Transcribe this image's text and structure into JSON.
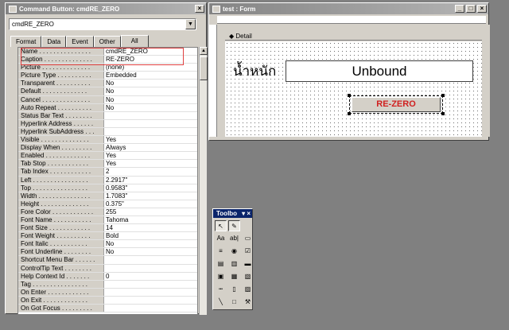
{
  "property_sheet": {
    "title": "Command Button: cmdRE_ZERO",
    "selector_value": "cmdRE_ZERO",
    "tabs": [
      "Format",
      "Data",
      "Event",
      "Other",
      "All"
    ],
    "active_tab": "All",
    "rows": [
      {
        "name": "Name . . . . . . . . . . . . . . .",
        "value": "cmdRE_ZERO"
      },
      {
        "name": "Caption . . . . . . . . . . . . . .",
        "value": "RE-ZERO"
      },
      {
        "name": "Picture . . . . . . . . . . . . . .",
        "value": "(none)"
      },
      {
        "name": "Picture Type . . . . . . . . . .",
        "value": "Embedded"
      },
      {
        "name": "Transparent . . . . . . . . . .",
        "value": "No"
      },
      {
        "name": "Default . . . . . . . . . . . . .",
        "value": "No"
      },
      {
        "name": "Cancel . . . . . . . . . . . . . .",
        "value": "No"
      },
      {
        "name": "Auto Repeat . . . . . . . . . .",
        "value": "No"
      },
      {
        "name": "Status Bar Text . . . . . . . .",
        "value": ""
      },
      {
        "name": "Hyperlink Address . . . . . .",
        "value": ""
      },
      {
        "name": "Hyperlink SubAddress . . .",
        "value": ""
      },
      {
        "name": "Visible . . . . . . . . . . . . . .",
        "value": "Yes"
      },
      {
        "name": "Display When . . . . . . . . .",
        "value": "Always"
      },
      {
        "name": "Enabled . . . . . . . . . . . . .",
        "value": "Yes"
      },
      {
        "name": "Tab Stop . . . . . . . . . . . .",
        "value": "Yes"
      },
      {
        "name": "Tab Index . . . . . . . . . . . .",
        "value": "2"
      },
      {
        "name": "Left . . . . . . . . . . . . . . . .",
        "value": "2.2917\""
      },
      {
        "name": "Top . . . . . . . . . . . . . . . .",
        "value": "0.9583\""
      },
      {
        "name": "Width . . . . . . . . . . . . . . .",
        "value": "1.7083\""
      },
      {
        "name": "Height . . . . . . . . . . . . . .",
        "value": "0.375\""
      },
      {
        "name": "Fore Color . . . . . . . . . . . .",
        "value": "255"
      },
      {
        "name": "Font Name . . . . . . . . . . .",
        "value": "Tahoma"
      },
      {
        "name": "Font Size . . . . . . . . . . . .",
        "value": "14"
      },
      {
        "name": "Font Weight . . . . . . . . . .",
        "value": "Bold"
      },
      {
        "name": "Font Italic . . . . . . . . . . .",
        "value": "No"
      },
      {
        "name": "Font Underline . . . . . . . .",
        "value": "No"
      },
      {
        "name": "Shortcut Menu Bar . . . . . .",
        "value": ""
      },
      {
        "name": "ControlTip Text . . . . . . . .",
        "value": ""
      },
      {
        "name": "Help Context Id . . . . . . .",
        "value": "0"
      },
      {
        "name": "Tag . . . . . . . . . . . . . . . .",
        "value": ""
      },
      {
        "name": "On Enter . . . . . . . . . . . .",
        "value": ""
      },
      {
        "name": "On Exit . . . . . . . . . . . . .",
        "value": ""
      },
      {
        "name": "On Got Focus . . . . . . . . .",
        "value": ""
      }
    ]
  },
  "form_window": {
    "title": "test : Form",
    "section_label": "Detail",
    "thai_label": "น้ำหนัก",
    "textbox_text": "Unbound",
    "button_caption": "RE-ZERO",
    "button_color": "#d02020"
  },
  "toolbox": {
    "title": "Toolbo",
    "tools": [
      "select-icon",
      "wizard-icon",
      "",
      "label-icon",
      "textbox-icon",
      "option-group-icon",
      "toggle-icon",
      "option-icon",
      "checkbox-icon",
      "combo-icon",
      "listbox-icon",
      "command-button-icon",
      "image-icon",
      "unbound-frame-icon",
      "bound-frame-icon",
      "page-break-icon",
      "tab-control-icon",
      "subform-icon",
      "line-icon",
      "rectangle-icon",
      "more-controls-icon"
    ],
    "tool_glyphs": [
      "↖",
      "✎",
      "",
      "Aa",
      "ab|",
      "▭",
      "≡",
      "◉",
      "☑",
      "▤",
      "▥",
      "▬",
      "▣",
      "▦",
      "▧",
      "┅",
      "▯",
      "▨",
      "╲",
      "□",
      "⚒"
    ]
  }
}
